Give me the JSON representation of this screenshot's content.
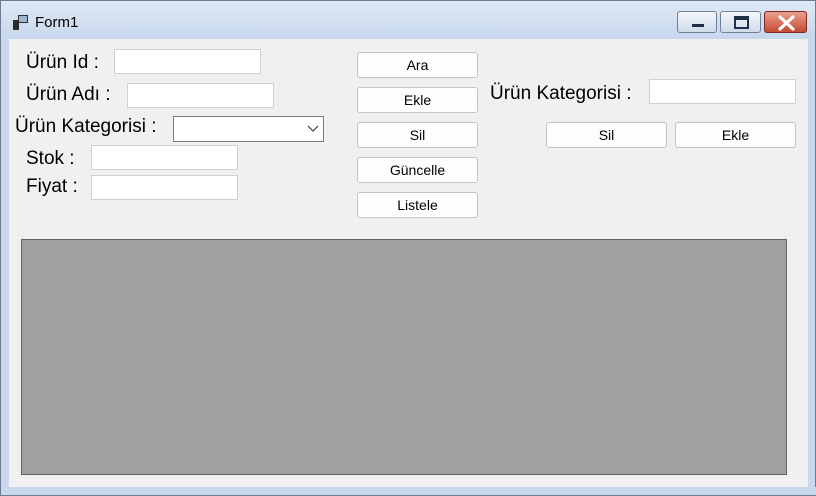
{
  "window": {
    "title": "Form1",
    "minimize_icon": "minimize-icon",
    "maximize_icon": "maximize-icon",
    "close_icon": "close-icon"
  },
  "form": {
    "id_label": "Ürün Id :",
    "name_label": "Ürün Adı :",
    "category_label": "Ürün Kategorisi :",
    "stock_label": "Stok :",
    "price_label": "Fiyat :",
    "id_value": "",
    "name_value": "",
    "category_value": "",
    "stock_value": "",
    "price_value": ""
  },
  "buttons": {
    "search": "Ara",
    "add": "Ekle",
    "delete": "Sil",
    "update": "Güncelle",
    "list": "Listele"
  },
  "category_panel": {
    "label": "Ürün Kategorisi :",
    "value": "",
    "delete": "Sil",
    "add": "Ekle"
  }
}
